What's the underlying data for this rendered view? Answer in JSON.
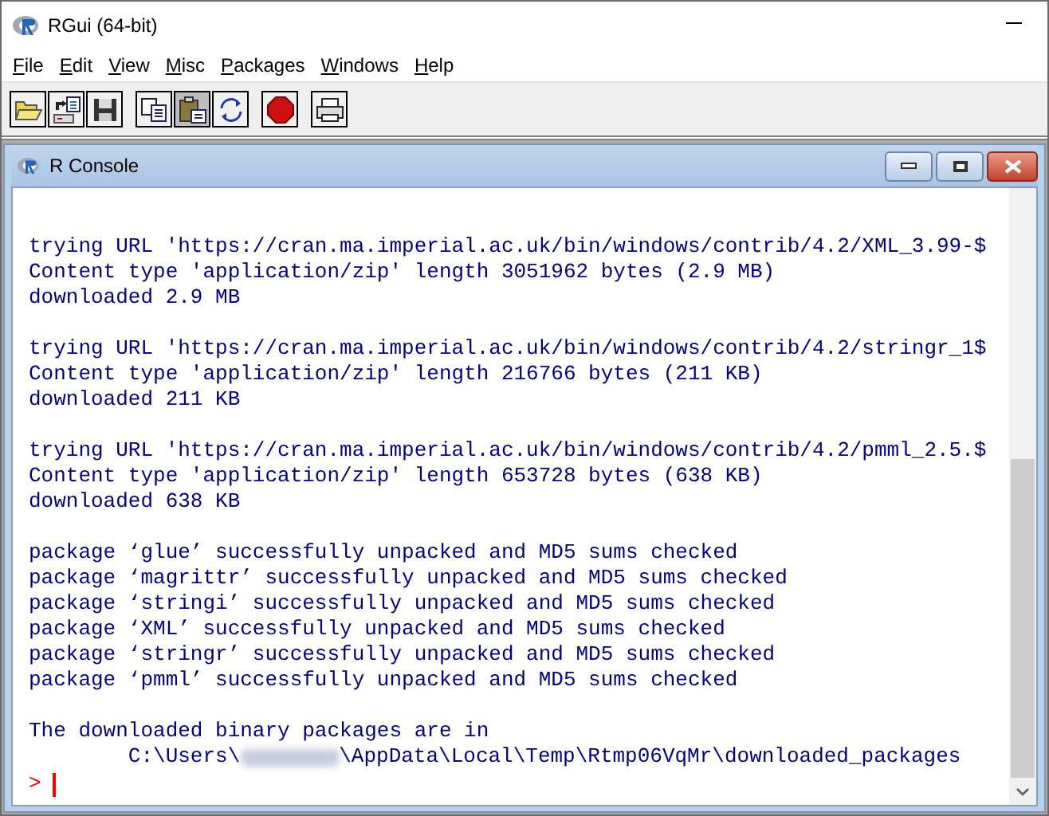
{
  "window": {
    "title": "RGui (64-bit)"
  },
  "menu": [
    {
      "label": "File"
    },
    {
      "label": "Edit"
    },
    {
      "label": "View"
    },
    {
      "label": "Misc"
    },
    {
      "label": "Packages"
    },
    {
      "label": "Windows"
    },
    {
      "label": "Help"
    }
  ],
  "toolbar": [
    {
      "kind": "open",
      "pressed": false
    },
    {
      "kind": "source",
      "pressed": false
    },
    {
      "kind": "save",
      "pressed": false
    },
    {
      "kind": "copy",
      "pressed": false
    },
    {
      "kind": "paste",
      "pressed": true
    },
    {
      "kind": "refresh",
      "pressed": false
    },
    {
      "kind": "stop",
      "pressed": false
    },
    {
      "kind": "print",
      "pressed": false
    }
  ],
  "console": {
    "title": "R Console",
    "lines": [
      {
        "kind": "blank"
      },
      {
        "kind": "text",
        "text": "trying URL 'https://cran.ma.imperial.ac.uk/bin/windows/contrib/4.2/XML_3.99-$"
      },
      {
        "kind": "text",
        "text": "Content type 'application/zip' length 3051962 bytes (2.9 MB)"
      },
      {
        "kind": "text",
        "text": "downloaded 2.9 MB"
      },
      {
        "kind": "blank"
      },
      {
        "kind": "text",
        "text": "trying URL 'https://cran.ma.imperial.ac.uk/bin/windows/contrib/4.2/stringr_1$"
      },
      {
        "kind": "text",
        "text": "Content type 'application/zip' length 216766 bytes (211 KB)"
      },
      {
        "kind": "text",
        "text": "downloaded 211 KB"
      },
      {
        "kind": "blank"
      },
      {
        "kind": "text",
        "text": "trying URL 'https://cran.ma.imperial.ac.uk/bin/windows/contrib/4.2/pmml_2.5.$"
      },
      {
        "kind": "text",
        "text": "Content type 'application/zip' length 653728 bytes (638 KB)"
      },
      {
        "kind": "text",
        "text": "downloaded 638 KB"
      },
      {
        "kind": "blank"
      },
      {
        "kind": "text",
        "text": "package ‘glue’ successfully unpacked and MD5 sums checked"
      },
      {
        "kind": "text",
        "text": "package ‘magrittr’ successfully unpacked and MD5 sums checked"
      },
      {
        "kind": "text",
        "text": "package ‘stringi’ successfully unpacked and MD5 sums checked"
      },
      {
        "kind": "text",
        "text": "package ‘XML’ successfully unpacked and MD5 sums checked"
      },
      {
        "kind": "text",
        "text": "package ‘stringr’ successfully unpacked and MD5 sums checked"
      },
      {
        "kind": "text",
        "text": "package ‘pmml’ successfully unpacked and MD5 sums checked"
      },
      {
        "kind": "blank"
      },
      {
        "kind": "text",
        "text": "The downloaded binary packages are in"
      },
      {
        "kind": "path",
        "before": "        C:\\Users\\",
        "after": "\\AppData\\Local\\Temp\\Rtmp06VqMr\\downloaded_packages"
      },
      {
        "kind": "prompt",
        "text": ">"
      }
    ]
  }
}
